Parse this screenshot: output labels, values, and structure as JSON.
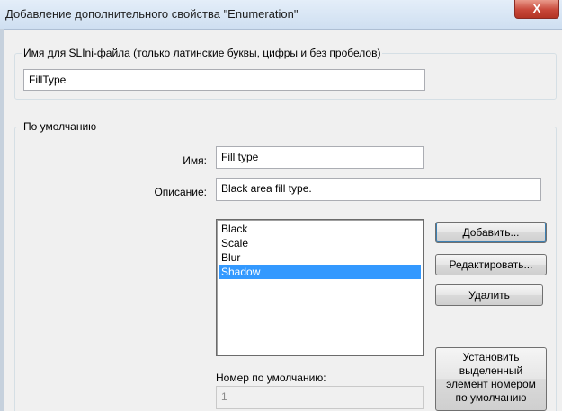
{
  "window": {
    "title": "Добавление дополнительного свойства \"Enumeration\"",
    "close_glyph": "X"
  },
  "ini_group": {
    "legend": "Имя для SLIni-файла (только латинские буквы, цифры и без пробелов)",
    "value": "FillType"
  },
  "default_group": {
    "legend": "По умолчанию",
    "name_label": "Имя:",
    "name_value": "Fill type",
    "description_label": "Описание:",
    "description_value": "Black area fill type.",
    "items": [
      {
        "label": "Black",
        "selected": false
      },
      {
        "label": "Scale",
        "selected": false
      },
      {
        "label": "Blur",
        "selected": false
      },
      {
        "label": "Shadow",
        "selected": true
      }
    ],
    "default_number_label": "Номер по умолчанию:",
    "default_number_value": "1"
  },
  "buttons": {
    "add": "Добавить...",
    "edit": "Редактировать...",
    "delete": "Удалить",
    "set_default": "Установить выделенный элемент номером по умолчанию"
  },
  "colors": {
    "selection": "#3399ff",
    "window_bg": "#f0f0f0",
    "close_button": "#c8483a"
  }
}
